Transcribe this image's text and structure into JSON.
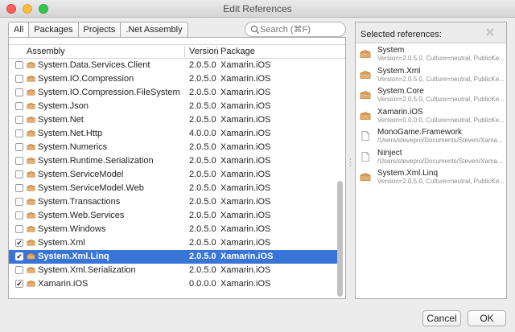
{
  "window": {
    "title": "Edit References"
  },
  "tabs": [
    {
      "label": "All",
      "active": true
    },
    {
      "label": "Packages",
      "active": false
    },
    {
      "label": "Projects",
      "active": false
    },
    {
      "label": ".Net Assembly",
      "active": false
    }
  ],
  "search": {
    "placeholder": "Search (⌘F)",
    "value": ""
  },
  "table": {
    "columns": [
      "Assembly",
      "Version",
      "Package"
    ],
    "rows": [
      {
        "checked": false,
        "name": "System.Data.Services.Client",
        "version": "2.0.5.0",
        "package": "Xamarin.iOS",
        "selected": false
      },
      {
        "checked": false,
        "name": "System.IO.Compression",
        "version": "2.0.5.0",
        "package": "Xamarin.iOS",
        "selected": false
      },
      {
        "checked": false,
        "name": "System.IO.Compression.FileSystem",
        "version": "2.0.5.0",
        "package": "Xamarin.iOS",
        "selected": false
      },
      {
        "checked": false,
        "name": "System.Json",
        "version": "2.0.5.0",
        "package": "Xamarin.iOS",
        "selected": false
      },
      {
        "checked": false,
        "name": "System.Net",
        "version": "2.0.5.0",
        "package": "Xamarin.iOS",
        "selected": false
      },
      {
        "checked": false,
        "name": "System.Net.Http",
        "version": "4.0.0.0",
        "package": "Xamarin.iOS",
        "selected": false
      },
      {
        "checked": false,
        "name": "System.Numerics",
        "version": "2.0.5.0",
        "package": "Xamarin.iOS",
        "selected": false
      },
      {
        "checked": false,
        "name": "System.Runtime.Serialization",
        "version": "2.0.5.0",
        "package": "Xamarin.iOS",
        "selected": false
      },
      {
        "checked": false,
        "name": "System.ServiceModel",
        "version": "2.0.5.0",
        "package": "Xamarin.iOS",
        "selected": false
      },
      {
        "checked": false,
        "name": "System.ServiceModel.Web",
        "version": "2.0.5.0",
        "package": "Xamarin.iOS",
        "selected": false
      },
      {
        "checked": false,
        "name": "System.Transactions",
        "version": "2.0.5.0",
        "package": "Xamarin.iOS",
        "selected": false
      },
      {
        "checked": false,
        "name": "System.Web.Services",
        "version": "2.0.5.0",
        "package": "Xamarin.iOS",
        "selected": false
      },
      {
        "checked": false,
        "name": "System.Windows",
        "version": "2.0.5.0",
        "package": "Xamarin.iOS",
        "selected": false
      },
      {
        "checked": true,
        "name": "System.Xml",
        "version": "2.0.5.0",
        "package": "Xamarin.iOS",
        "selected": false
      },
      {
        "checked": true,
        "name": "System.Xml.Linq",
        "version": "2.0.5.0",
        "package": "Xamarin.iOS",
        "selected": true
      },
      {
        "checked": false,
        "name": "System.Xml.Serialization",
        "version": "2.0.5.0",
        "package": "Xamarin.iOS",
        "selected": false
      },
      {
        "checked": true,
        "name": "Xamarin.iOS",
        "version": "0.0.0.0",
        "package": "Xamarin.iOS",
        "selected": false
      }
    ]
  },
  "selected_panel": {
    "title": "Selected references:",
    "clear_icon": "close-icon",
    "items": [
      {
        "name": "System",
        "detail": "Version=2.0.5.0, Culture=neutral, PublicKe...",
        "icon": "package-icon"
      },
      {
        "name": "System.Xml",
        "detail": "Version=2.0.5.0, Culture=neutral, PublicKe...",
        "icon": "package-icon"
      },
      {
        "name": "System.Core",
        "detail": "Version=2.0.5.0, Culture=neutral, PublicKe...",
        "icon": "package-icon"
      },
      {
        "name": "Xamarin.iOS",
        "detail": "Version=0.0.0.0, Culture=neutral, PublicKe...",
        "icon": "package-icon"
      },
      {
        "name": "MonoGame.Framework",
        "detail": "/Users/stevepro/Documents/Steven/Xama...",
        "icon": "file-icon"
      },
      {
        "name": "Ninject",
        "detail": "/Users/stevepro/Documents/Steven/Xama...",
        "icon": "file-icon"
      },
      {
        "name": "System.Xml.Linq",
        "detail": "Version=2.0.5.0, Culture=neutral, PublicKe...",
        "icon": "package-icon"
      }
    ]
  },
  "buttons": {
    "cancel": "Cancel",
    "ok": "OK"
  },
  "colors": {
    "selection": "#3875d7",
    "package_icon": "#e8b06a"
  }
}
